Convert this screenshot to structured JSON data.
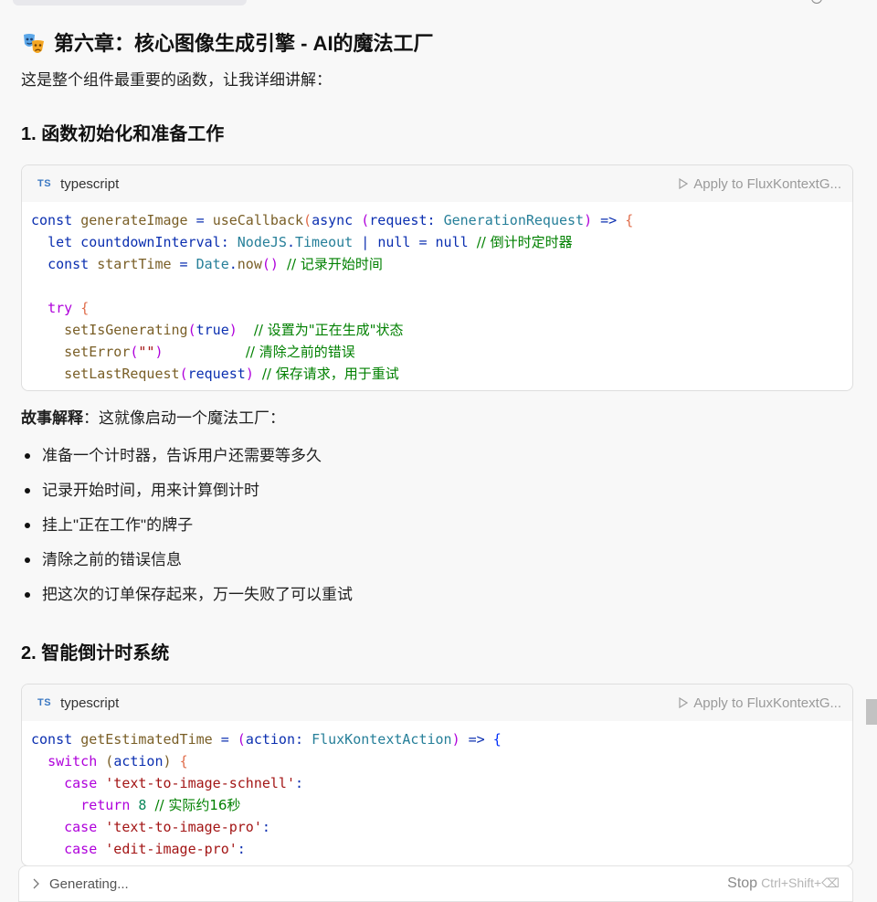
{
  "chapter": {
    "icon": "performing-arts-icon",
    "title": "第六章：核心图像生成引擎 - AI的魔法工厂"
  },
  "intro": "这是整个组件最重要的函数，让我详细讲解：",
  "sections": [
    {
      "heading": "1. 函数初始化和准备工作",
      "code": {
        "lang_badge": "TS",
        "lang": "typescript",
        "apply_label": "Apply to FluxKontextG...",
        "comments": {
          "c1": "// 倒计时定时器",
          "c2": "// 记录开始时间",
          "c3": "// 设置为\"正在生成\"状态",
          "c4": "// 清除之前的错误",
          "c5": "// 保存请求，用于重试"
        }
      }
    },
    {
      "heading": "2. 智能倒计时系统",
      "code": {
        "lang_badge": "TS",
        "lang": "typescript",
        "apply_label": "Apply to FluxKontextG...",
        "comments": {
          "c1": "// 实际约16秒"
        }
      }
    }
  ],
  "story": {
    "label": "故事解释",
    "text": "：这就像启动一个魔法工厂：",
    "bullets": [
      "准备一个计时器，告诉用户还需要等多久",
      "记录开始时间，用来计算倒计时",
      "挂上\"正在工作\"的牌子",
      "清除之前的错误信息",
      "把这次的订单保存起来，万一失败了可以重试"
    ]
  },
  "status_bar": {
    "generating": "Generating...",
    "stop_label": "Stop",
    "shortcut": "Ctrl+Shift+⌫"
  }
}
